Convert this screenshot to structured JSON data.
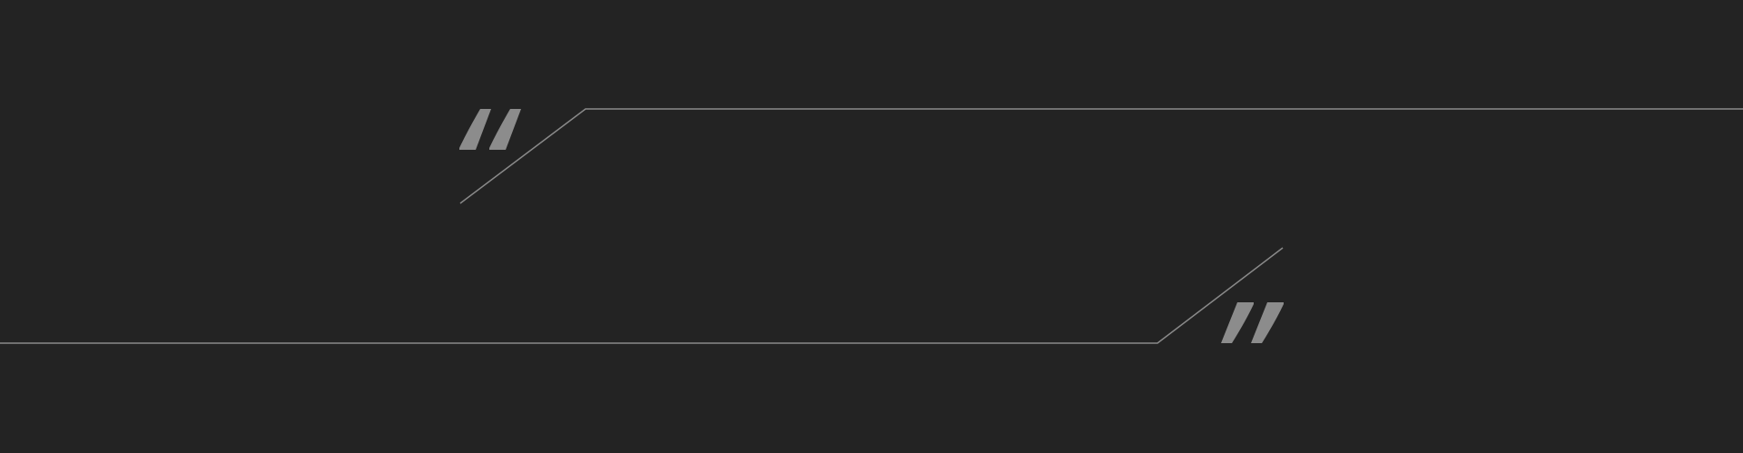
{
  "colors": {
    "background": "#232323",
    "line": "#8a8a8a",
    "quote_mark": "#8c8c8c"
  },
  "icons": {
    "opening": "opening-quote-icon",
    "closing": "closing-quote-icon"
  }
}
